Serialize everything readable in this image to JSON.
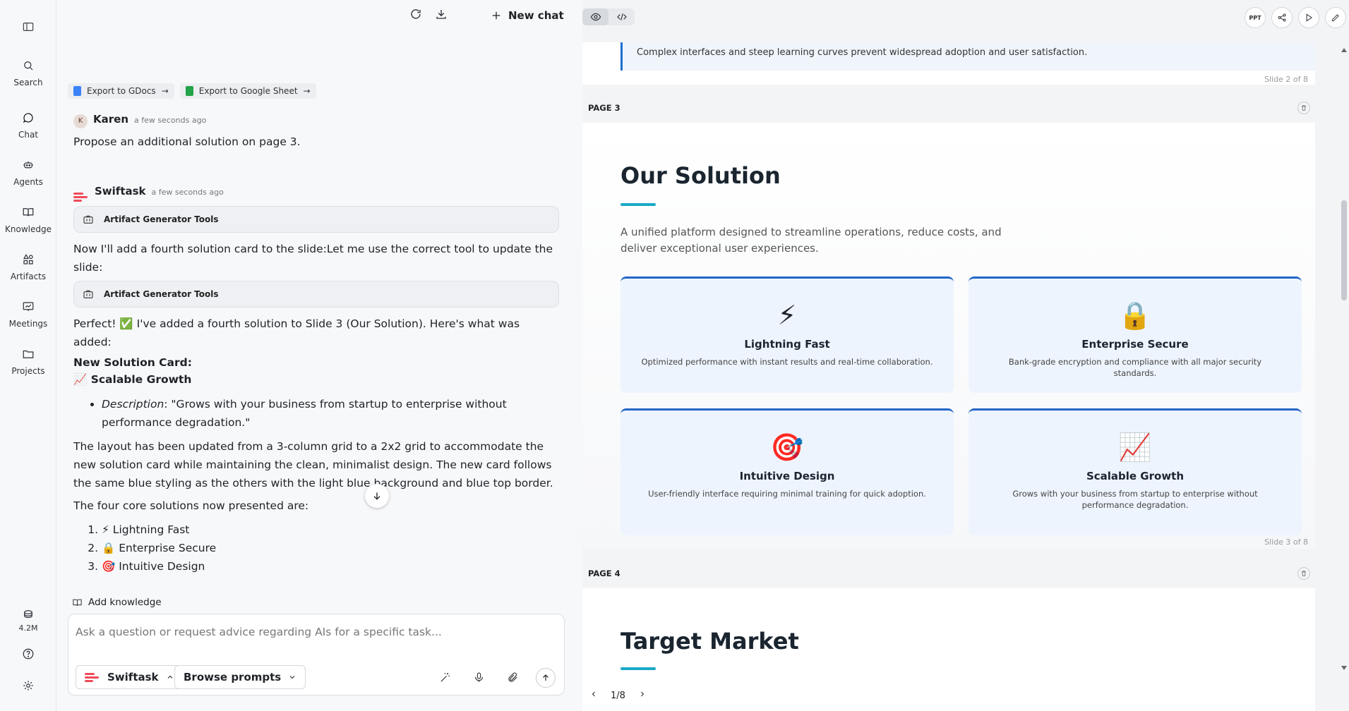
{
  "rail": {
    "items": [
      {
        "label": "Search"
      },
      {
        "label": "Chat"
      },
      {
        "label": "Agents"
      },
      {
        "label": "Knowledge"
      },
      {
        "label": "Artifacts"
      },
      {
        "label": "Meetings"
      },
      {
        "label": "Projects"
      }
    ],
    "credits": "4.2M"
  },
  "chat": {
    "new_chat": "New chat",
    "exports": [
      "Export to GDocs",
      "Export to Google Sheet"
    ],
    "user_msg": {
      "name": "Karen",
      "time": "a few seconds ago",
      "text": "Propose an additional solution on page 3."
    },
    "bot_msg": {
      "name": "Swiftask",
      "time": "a few seconds ago",
      "tool_label": "Artifact Generator Tools",
      "line1": "Now I'll add a fourth solution card to the slide:Let me use the correct tool to update the slide:",
      "line2": "Perfect! ✅ I've added a fourth solution to Slide 3 (Our Solution). Here's what was added:",
      "card_heading": "New Solution Card:",
      "card_name": "📈 Scalable Growth",
      "desc_label": "Description",
      "desc_text": ": \"Grows with your business from startup to enterprise without performance degradation.\"",
      "layout_text": "The layout has been updated from a 3-column grid to a 2x2 grid to accommodate the new solution card while maintaining the clean, minimalist design. The new card follows the same blue styling as the others with the light blue background and blue top border.",
      "four_core": "The four core solutions now presented are:",
      "solutions": [
        "⚡ Lightning Fast",
        "🔒 Enterprise Secure",
        "🎯 Intuitive Design"
      ]
    },
    "add_knowledge": "Add knowledge",
    "composer_placeholder": "Ask a question or request advice regarding AIs for a specific task...",
    "agent_select": "Swiftask",
    "prompts_select": "Browse prompts"
  },
  "preview": {
    "ppt_label": "PPT",
    "callout_text": "Complex interfaces and steep learning curves prevent widespread adoption and user satisfaction.",
    "slide2_num": "Slide 2 of 8",
    "page3_label": "PAGE 3",
    "slide3": {
      "title": "Our Solution",
      "subtitle": "A unified platform designed to streamline operations, reduce costs, and deliver exceptional user experiences.",
      "cards": [
        {
          "emoji": "⚡",
          "title": "Lightning Fast",
          "desc": "Optimized performance with instant results and real-time collaboration."
        },
        {
          "emoji": "🔒",
          "title": "Enterprise Secure",
          "desc": "Bank-grade encryption and compliance with all major security standards."
        },
        {
          "emoji": "🎯",
          "title": "Intuitive Design",
          "desc": "User-friendly interface requiring minimal training for quick adoption."
        },
        {
          "emoji": "📈",
          "title": "Scalable Growth",
          "desc": "Grows with your business from startup to enterprise without performance degradation."
        }
      ],
      "num": "Slide 3 of 8"
    },
    "page4_label": "PAGE 4",
    "slide4_title": "Target Market",
    "pager": "1/8"
  },
  "colors": {
    "accent_teal": "#19a9c7",
    "card_border": "#2466c8",
    "brand_red": "#ef4b5a"
  }
}
